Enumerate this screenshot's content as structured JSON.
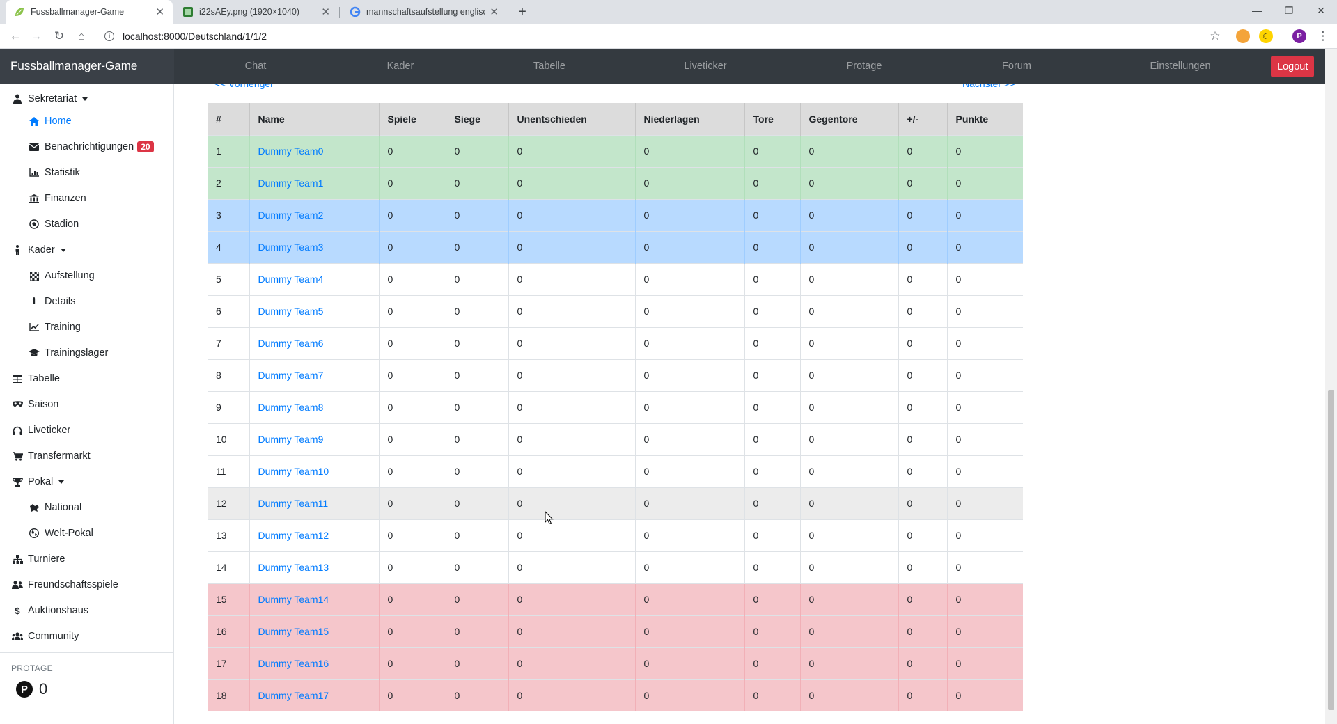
{
  "browser": {
    "tabs": [
      {
        "title": "Fussballmanager-Game",
        "active": true
      },
      {
        "title": "i22sAEy.png (1920×1040)",
        "active": false
      },
      {
        "title": "mannschaftsaufstellung englisch",
        "active": false
      }
    ],
    "url": "localhost:8000/Deutschland/1/1/2",
    "profile_initial": "P"
  },
  "app": {
    "brand": "Fussballmanager-Game",
    "nav": [
      "Chat",
      "Kader",
      "Tabelle",
      "Liveticker",
      "Protage",
      "Forum",
      "Einstellungen"
    ],
    "logout_label": "Logout"
  },
  "sidebar": {
    "items": [
      {
        "label": "Sekretariat",
        "icon": "user-tie-icon",
        "level": 0,
        "dropdown": true
      },
      {
        "label": "Home",
        "icon": "home-icon",
        "level": 1,
        "active": true
      },
      {
        "label": "Benachrichtigungen",
        "icon": "envelope-icon",
        "level": 1,
        "badge": "20"
      },
      {
        "label": "Statistik",
        "icon": "chart-icon",
        "level": 1
      },
      {
        "label": "Finanzen",
        "icon": "bank-icon",
        "level": 1
      },
      {
        "label": "Stadion",
        "icon": "football-icon",
        "level": 1
      },
      {
        "label": "Kader",
        "icon": "person-icon",
        "level": 0,
        "dropdown": true
      },
      {
        "label": "Aufstellung",
        "icon": "chess-board-icon",
        "level": 1
      },
      {
        "label": "Details",
        "icon": "info-icon",
        "level": 1
      },
      {
        "label": "Training",
        "icon": "line-chart-icon",
        "level": 1
      },
      {
        "label": "Trainingslager",
        "icon": "graduation-cap-icon",
        "level": 1
      },
      {
        "label": "Tabelle",
        "icon": "table-icon",
        "level": 0
      },
      {
        "label": "Saison",
        "icon": "mask-icon",
        "level": 0
      },
      {
        "label": "Liveticker",
        "icon": "headphones-icon",
        "level": 0
      },
      {
        "label": "Transfermarkt",
        "icon": "cart-icon",
        "level": 0
      },
      {
        "label": "Pokal",
        "icon": "trophy-icon",
        "level": 0,
        "dropdown": true
      },
      {
        "label": "National",
        "icon": "map-icon",
        "level": 1
      },
      {
        "label": "Welt-Pokal",
        "icon": "globe-icon",
        "level": 1
      },
      {
        "label": "Turniere",
        "icon": "sitemap-icon",
        "level": 0
      },
      {
        "label": "Freundschaftsspiele",
        "icon": "users-icon",
        "level": 0
      },
      {
        "label": "Auktionshaus",
        "icon": "dollar-icon",
        "level": 0
      },
      {
        "label": "Community",
        "icon": "users-cog-icon",
        "level": 0
      }
    ],
    "protage_heading": "PROTAGE",
    "protage_coin": "P",
    "protage_value": "0"
  },
  "main": {
    "prev_label": "<< Vorheriger",
    "next_label": "Nächster >>",
    "table": {
      "headers": [
        "#",
        "Name",
        "Spiele",
        "Siege",
        "Unentschieden",
        "Niederlagen",
        "Tore",
        "Gegentore",
        "+/-",
        "Punkte"
      ],
      "rows": [
        {
          "zone": "green",
          "cells": [
            "1",
            "Dummy Team0",
            "0",
            "0",
            "0",
            "0",
            "0",
            "0",
            "0",
            "0"
          ]
        },
        {
          "zone": "green",
          "cells": [
            "2",
            "Dummy Team1",
            "0",
            "0",
            "0",
            "0",
            "0",
            "0",
            "0",
            "0"
          ]
        },
        {
          "zone": "blue",
          "cells": [
            "3",
            "Dummy Team2",
            "0",
            "0",
            "0",
            "0",
            "0",
            "0",
            "0",
            "0"
          ]
        },
        {
          "zone": "blue",
          "cells": [
            "4",
            "Dummy Team3",
            "0",
            "0",
            "0",
            "0",
            "0",
            "0",
            "0",
            "0"
          ]
        },
        {
          "zone": "",
          "cells": [
            "5",
            "Dummy Team4",
            "0",
            "0",
            "0",
            "0",
            "0",
            "0",
            "0",
            "0"
          ]
        },
        {
          "zone": "",
          "cells": [
            "6",
            "Dummy Team5",
            "0",
            "0",
            "0",
            "0",
            "0",
            "0",
            "0",
            "0"
          ]
        },
        {
          "zone": "",
          "cells": [
            "7",
            "Dummy Team6",
            "0",
            "0",
            "0",
            "0",
            "0",
            "0",
            "0",
            "0"
          ]
        },
        {
          "zone": "",
          "cells": [
            "8",
            "Dummy Team7",
            "0",
            "0",
            "0",
            "0",
            "0",
            "0",
            "0",
            "0"
          ]
        },
        {
          "zone": "",
          "cells": [
            "9",
            "Dummy Team8",
            "0",
            "0",
            "0",
            "0",
            "0",
            "0",
            "0",
            "0"
          ]
        },
        {
          "zone": "",
          "cells": [
            "10",
            "Dummy Team9",
            "0",
            "0",
            "0",
            "0",
            "0",
            "0",
            "0",
            "0"
          ]
        },
        {
          "zone": "",
          "cells": [
            "11",
            "Dummy Team10",
            "0",
            "0",
            "0",
            "0",
            "0",
            "0",
            "0",
            "0"
          ]
        },
        {
          "zone": "hover",
          "cells": [
            "12",
            "Dummy Team11",
            "0",
            "0",
            "0",
            "0",
            "0",
            "0",
            "0",
            "0"
          ]
        },
        {
          "zone": "",
          "cells": [
            "13",
            "Dummy Team12",
            "0",
            "0",
            "0",
            "0",
            "0",
            "0",
            "0",
            "0"
          ]
        },
        {
          "zone": "",
          "cells": [
            "14",
            "Dummy Team13",
            "0",
            "0",
            "0",
            "0",
            "0",
            "0",
            "0",
            "0"
          ]
        },
        {
          "zone": "red",
          "cells": [
            "15",
            "Dummy Team14",
            "0",
            "0",
            "0",
            "0",
            "0",
            "0",
            "0",
            "0"
          ]
        },
        {
          "zone": "red",
          "cells": [
            "16",
            "Dummy Team15",
            "0",
            "0",
            "0",
            "0",
            "0",
            "0",
            "0",
            "0"
          ]
        },
        {
          "zone": "red",
          "cells": [
            "17",
            "Dummy Team16",
            "0",
            "0",
            "0",
            "0",
            "0",
            "0",
            "0",
            "0"
          ]
        },
        {
          "zone": "red",
          "cells": [
            "18",
            "Dummy Team17",
            "0",
            "0",
            "0",
            "0",
            "0",
            "0",
            "0",
            "0"
          ]
        }
      ]
    }
  },
  "colors": {
    "navbar": "#343a40",
    "logout": "#dc3545",
    "link": "#007bff",
    "promotion": "#c3e6cb",
    "qualification": "#b8daff",
    "relegation": "#f5c6cb",
    "badge": "#dc3545"
  }
}
